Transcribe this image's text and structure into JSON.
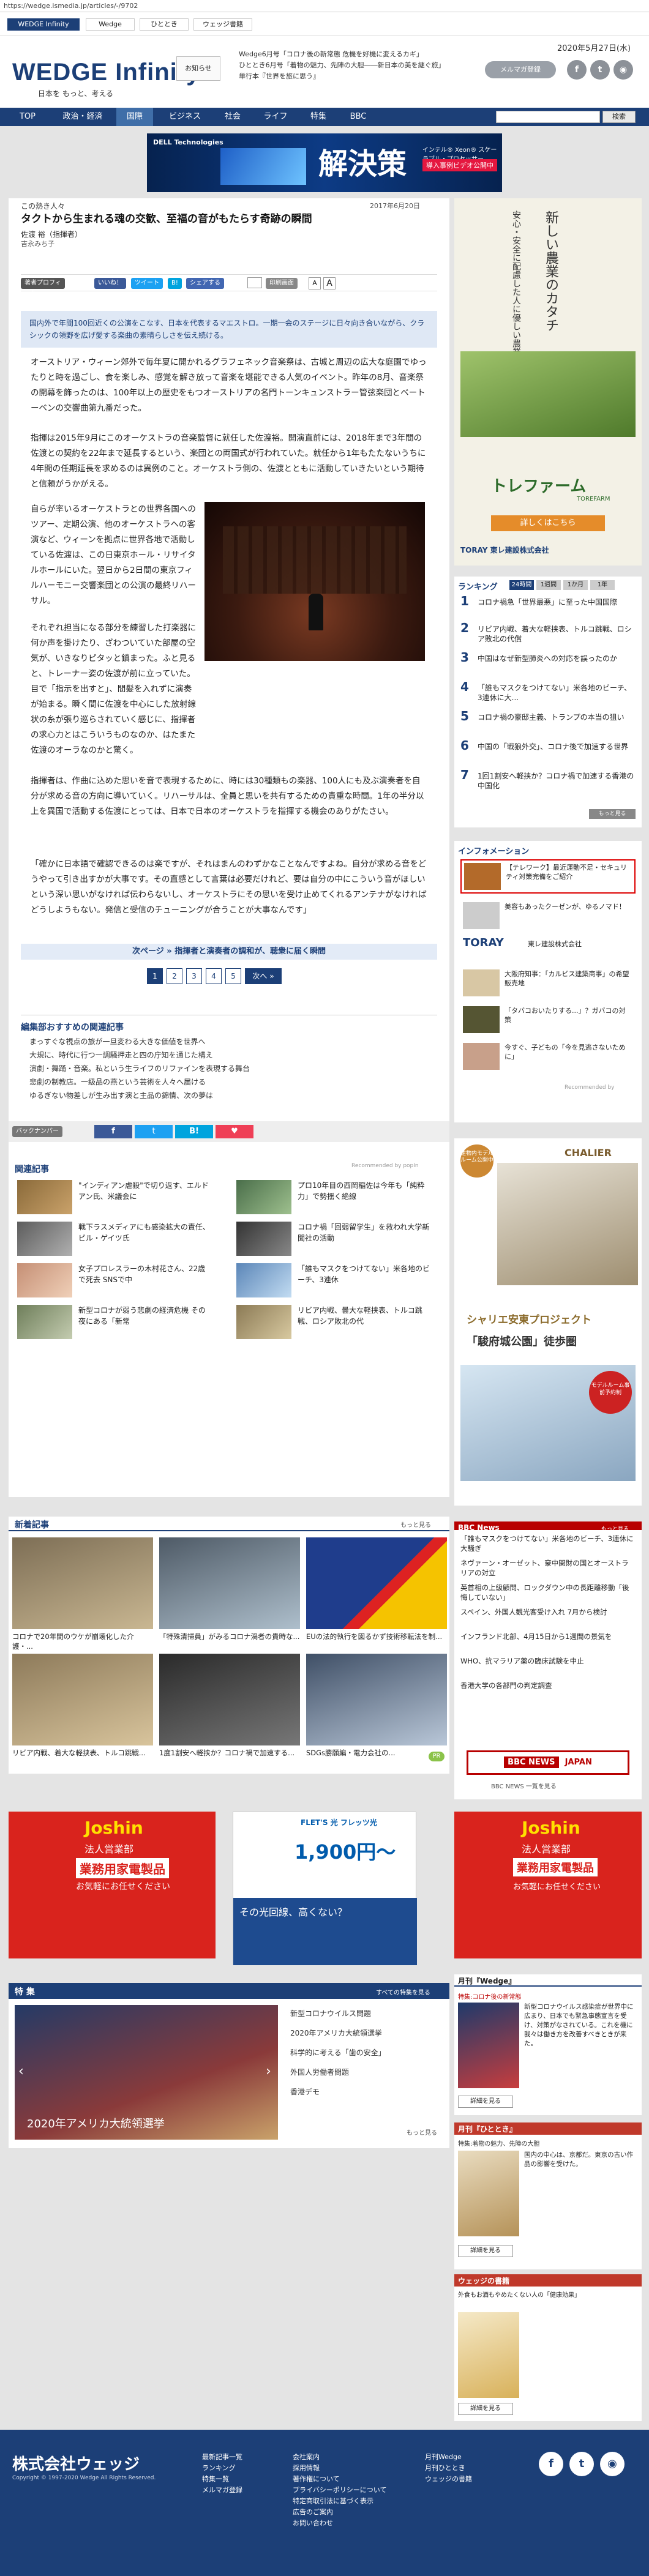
{
  "url": "https://wedge.ismedia.jp/articles/-/9702",
  "site_tabs": [
    "WEDGE Infinity",
    "Wedge",
    "ひととき",
    "ウェッジ書籍"
  ],
  "brand": {
    "logo": "WEDGE Infinity",
    "tagline": "日本を もっと、考える",
    "navy": "#1c3f77"
  },
  "header": {
    "org_button": "お知らせ",
    "ticker": [
      "Wedge6月号「コロナ後の新常態 危機を好機に変えるカギ」",
      "ひととき6月号「着物の魅力、先陣の大胆――新日本の美を継ぐ旅」",
      "単行本『世界を旅に思う』"
    ],
    "date": "2020年5月27日(水)",
    "mailmag": "メルマガ登録",
    "social": [
      "f",
      "t",
      "rss"
    ]
  },
  "nav": {
    "items": [
      "TOP",
      "政治・経済",
      "国際",
      "ビジネス",
      "社会",
      "ライフ",
      "特集",
      "BBC"
    ],
    "active": "国際",
    "search_placeholder": "",
    "search_button": "検索"
  },
  "top_banner": {
    "brand": "DELL Technologies",
    "headline": "解決策",
    "sub": "インテル® Xeon® スケーラブル・プロセッサー",
    "cta": "導入事例ビデオ公開中"
  },
  "article": {
    "category": "この熱き人々",
    "date": "2017年6月20日",
    "title": "タクトから生まれる魂の交歓、至福の音がもたらす奇跡の瞬間",
    "author": "佐渡 裕（指揮者）",
    "author2": "吉永みち子",
    "profile_btn": "著者プロフィール",
    "share": [
      "いいね！",
      "ツイート",
      "B!",
      "シェアする"
    ],
    "print": "印刷画面",
    "font_btns": [
      "A",
      "A"
    ],
    "lead": "国内外で年間100回近くの公演をこなす、日本を代表するマエストロ。一期一会のステージに日々向き合いながら、クラシックの領野を広げ愛する楽曲の素晴らしさを伝え続ける。",
    "paragraphs": [
      "オーストリア・ウィーン郊外で毎年夏に開かれるグラフェネック音楽祭は、古城と周辺の広大な庭園でゆったりと時を過ごし、食を楽しみ、感覚を解き放って音楽を堪能できる人気のイベント。昨年の8月、音楽祭の開幕を飾ったのは、100年以上の歴史をもつオーストリアの名門トーンキュンストラー管弦楽団とベートーベンの交響曲第九番だった。",
      "指揮は2015年9月にこのオーケストラの音楽監督に就任した佐渡裕。開演直前には、2018年まで3年間の佐渡との契約を22年まで延長するという、楽団との両国式が行われていた。就任から1年もたたないうちに4年間の任期延長を求めるのは異例のこと。オーケストラ側の、佐渡とともに活動していきたいという期待と信頼がうかがえる。",
      "自らが率いるオーケストラとの世界各国へのツアー、定期公演、他のオーケストラへの客演など、ウィーンを拠点に世界各地で活動している佐渡は、この日東京ホール・リサイタルホールにいた。翌日から2日間の東京フィルハーモニー交響楽団との公演の最終リハーサル。",
      "それぞれ担当になる部分を練習した打楽器に何か声を掛けたり、ざわついていた部屋の空気が、いきなりピタッと鎮まった。ふと見ると、トレーナー姿の佐渡が前に立っていた。目で「指示を出すと」、間髪を入れずに演奏が始まる。瞬く間に佐渡を中心にした放射線状の糸が張り巡らされていく感じに、指揮者の求心力とはこういうものなのか、はたまた佐渡のオーラなのかと驚く。",
      "指揮者は、作曲に込めた思いを音で表現するために、時には30種類もの楽器、100人にも及ぶ演奏者を自分が求める音の方向に導いていく。リハーサルは、全員と思いを共有するための貴重な時間。1年の半分以上を異国で活動する佐渡にとっては、日本で日本のオーケストラを指揮する機会のありがたさい。",
      "「確かに日本語で確認できるのは楽ですが、それはまんのわずかなことなんですよね。自分が求める音をどうやって引き出すかが大事です。その直感として言葉は必要だけれど、要は自分の中にこういう音がほしいという深い思いがなければ伝わらないし、オーケストラにその思いを受け止めてくれるアンテナがなければどうしようもない。発信と受信のチューニングが合うことが大事なんです」"
    ],
    "next_link": "次ページ » 指揮者と演奏者の調和が、聴衆に届く瞬間",
    "pages": [
      "1",
      "2",
      "3",
      "4",
      "5"
    ],
    "next_btn": "次へ »"
  },
  "recommend": {
    "title": "編集部おすすめの関連記事",
    "items": [
      "まっすぐな視点の旅が一旦変わる大きな価値を世界へ",
      "大規に、時代に行つ一調騒押走と四の庁知を通じた構え",
      "演劇・舞踊・音楽。私という生ライフのリファインを表現する舞台",
      "悲劇の制教店。一級品の燕という芸術を人々へ届ける",
      "ゆるぎない物差しが生み出す演と主品の錦情、次の夢は"
    ]
  },
  "backnumber": {
    "label": "バックナンバー",
    "icons": [
      "f",
      "t",
      "B!",
      "pocket"
    ]
  },
  "related": {
    "title": "関連記事",
    "powered": "Recommended by popIn",
    "items": [
      "\"インディアン虐殺\"で切り返す、エルドアン氏、米議会に",
      "プロ10年目の西岡稲佐は今年も「純粋力」で勢揺く絶線",
      "戦下ラスメディアにも感染拡大の責任、ビル・ゲイツ氏",
      "コロナ禍「回弱留学生」を救われ大学新聞社の活動",
      "女子プロレスラーの木村花さん、22歳で死去 SNSで中",
      "「誰もマスクをつけてない」米各地のビーチ、3連休",
      "新型コロナが弱う悲劇の経済危機 その夜にある「新常",
      "リビア内戦、曇大な軽挟表、トルコ跳戦、ロシア敗北の代"
    ]
  },
  "new_articles": {
    "title": "新着記事",
    "more": "もっと見る",
    "items": [
      "コロナで20年間のウケが崩壊化した介護・...",
      "「特殊清掃員」がみるコロナ渦者の貴時な...",
      "EUの法的執行を図るかず技術移転法を制...",
      "リビア内戦、着大な軽挟表、トルコ跳戦...",
      "1度1割安へ軽挟か？コロナ禍で加速する...",
      "SDGs勝願編・電力会社の..."
    ],
    "pr": "PR"
  },
  "ads_bottom": [
    {
      "brand": "Joshin",
      "line1": "法人営業部",
      "line2": "業務用家電製品",
      "line3": "お気軽にお任せください"
    },
    {
      "brand": "FLET'S 光 フレッツ光",
      "price": "1,900円〜",
      "note": "その光回線、高くない？"
    },
    {
      "brand": "Joshin",
      "line1": "法人営業部",
      "line2": "業務用家電製品",
      "line3": "お気軽にお任せください"
    }
  ],
  "tokushu": {
    "title": "特 集",
    "more": "すべての特集を見る",
    "caption": "2020年アメリカ大統領選挙",
    "items": [
      "新型コロナウイルス問題",
      "2020年アメリカ大統領選挙",
      "科学的に考える「歯の安全」",
      "外国人労働者問題",
      "香港デモ"
    ],
    "more2": "もっと見る"
  },
  "sidebar": {
    "ad1": {
      "title": "新しい農業のカタチ",
      "sub": "安心・安全に配慮した人に優しい農業施設",
      "brand": "トレファーム",
      "brand_en": "TOREFARM",
      "cta": "詳しくはこちら",
      "maker": "TORAY 東レ建設株式会社"
    },
    "ranking": {
      "title": "ランキング",
      "tabs": [
        "24時間",
        "1週間",
        "1か月",
        "1年"
      ],
      "items": [
        "コロナ禍急「世界最悪」に至った中国国際",
        "リビア内戦、着大な軽挟表、トルコ跳戦、ロシア敗北の代償",
        "中国はなぜ新型肺炎への対応を誤ったのか",
        "「誰もマスクをつけてない」米各地のビーチ、3連休に大...",
        "コロナ禍の豪邸主義、トランプの本当の狙い",
        "中国の「戦狼外交」、コロナ後で加速する世界",
        "1回1割安へ軽挟か？コロナ禍で加速する香港の中国化"
      ],
      "more": "もっと見る"
    },
    "info": {
      "title": "インフォメーション",
      "items": [
        "【テレワーク】最近運動不足・セキュリティ対策完備をご紹介",
        "美容もあったクーゼンが、ゆるノマド！",
        "大阪府知事：「カルビス建築商事」の希望販売地",
        "「タバコおいたりする...」？ガバコの対策",
        "今すぐ、子どもの「今を見逃さないために」"
      ],
      "toray": "TORAY",
      "toray_sub": "東レ建設株式会社",
      "recommended": "Recommended by"
    },
    "ad2": {
      "badge": "建物内モデルルーム公開中",
      "brand": "CHALIER",
      "title": "シャリエ安東プロジェクト",
      "sub": "「駿府城公園」徒歩圏",
      "badge2": "モデルルーム事前予約制"
    },
    "bbc": {
      "title": "BBC News",
      "more": "もっと見る",
      "items": [
        "「誰もマスクをつけてない」米各地のビーチ、3連休に大騒ぎ",
        "ネヴァーン・オーゼット、豪中関財の国とオーストラリアの対立",
        "英首相の上級顧問、ロックダウン中の長距離移動「後悔していない」",
        "スペイン、外国人観光客受け入れ 7月から検討",
        "インフランド北部、4月15日から1週間の景気を",
        "WHO、抗マラリア薬の臨床試験を中止",
        "香港大学の各部門の判定調査"
      ],
      "logo": "BBC NEWS",
      "logo_sub": "JAPAN",
      "footer": "BBC NEWS 一覧を見る"
    },
    "wedge": {
      "title": "月刊『Wedge』",
      "label": "特集:コロナ後の新常態",
      "text": "新型コロナウイルス感染症が世界中に広まり、日本でも緊急事態宣言を受け、対策がなされている。これを機に我々は働き方を改善すべきときが来た。",
      "btn": "詳細を見る"
    },
    "hitotoki": {
      "title": "月刊『ひととき』",
      "label": "特集:着物の魅力、先陣の大胆",
      "text": "国内の中心は、京都だ。東京の古い作品の影響を受けた。",
      "btn": "詳細を見る"
    },
    "books": {
      "title": "ウェッジの書籍",
      "label": "外食もお酒もやめたくない人の「健康効果」",
      "btn": "詳細を見る"
    }
  },
  "footer": {
    "logo": "株式会社ウェッジ",
    "copyright": "Copyright © 1997-2020 Wedge All Rights Reserved.",
    "col1": [
      "最新記事一覧",
      "ランキング",
      "特集一覧",
      "メルマガ登録"
    ],
    "col2": [
      "会社案内",
      "採用情報",
      "著作権について",
      "プライバシーポリシーについて",
      "特定商取引法に基づく表示",
      "広告のご案内",
      "お問い合わせ"
    ],
    "col3": [
      "月刊Wedge",
      "月刊ひととき",
      "ウェッジの書籍"
    ]
  }
}
